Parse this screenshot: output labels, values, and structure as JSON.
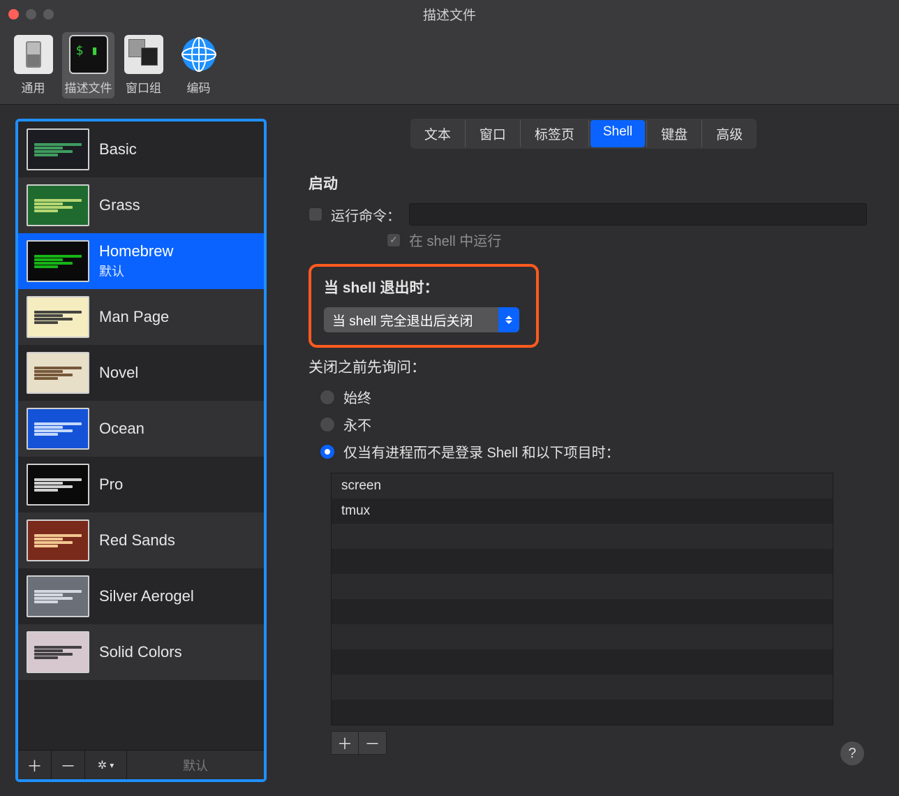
{
  "window": {
    "title": "描述文件"
  },
  "toolbar": {
    "general": "通用",
    "profiles": "描述文件",
    "windows": "窗口组",
    "encoding": "编码"
  },
  "profiles": [
    {
      "name": "Basic",
      "theme": "th-basic"
    },
    {
      "name": "Grass",
      "theme": "th-grass"
    },
    {
      "name": "Homebrew",
      "theme": "th-home",
      "selected": true,
      "sub": "默认"
    },
    {
      "name": "Man Page",
      "theme": "th-man"
    },
    {
      "name": "Novel",
      "theme": "th-novel"
    },
    {
      "name": "Ocean",
      "theme": "th-ocean"
    },
    {
      "name": "Pro",
      "theme": "th-pro"
    },
    {
      "name": "Red Sands",
      "theme": "th-red"
    },
    {
      "name": "Silver Aerogel",
      "theme": "th-silver"
    },
    {
      "name": "Solid Colors",
      "theme": "th-solid"
    }
  ],
  "sidebar_footer": {
    "default_btn": "默认"
  },
  "tabs": [
    "文本",
    "窗口",
    "标签页",
    "Shell",
    "键盘",
    "高级"
  ],
  "active_tab": "Shell",
  "shell": {
    "section_startup": "启动",
    "run_cmd_label": "运行命令：",
    "run_in_shell_label": "在 shell 中运行",
    "on_exit_label": "当 shell 退出时：",
    "on_exit_value": "当 shell 完全退出后关闭",
    "ask_before_close_label": "关闭之前先询问：",
    "radios": {
      "always": "始终",
      "never": "永不",
      "processes": "仅当有进程而不是登录 Shell 和以下项目时："
    },
    "processes": [
      "screen",
      "tmux"
    ]
  }
}
